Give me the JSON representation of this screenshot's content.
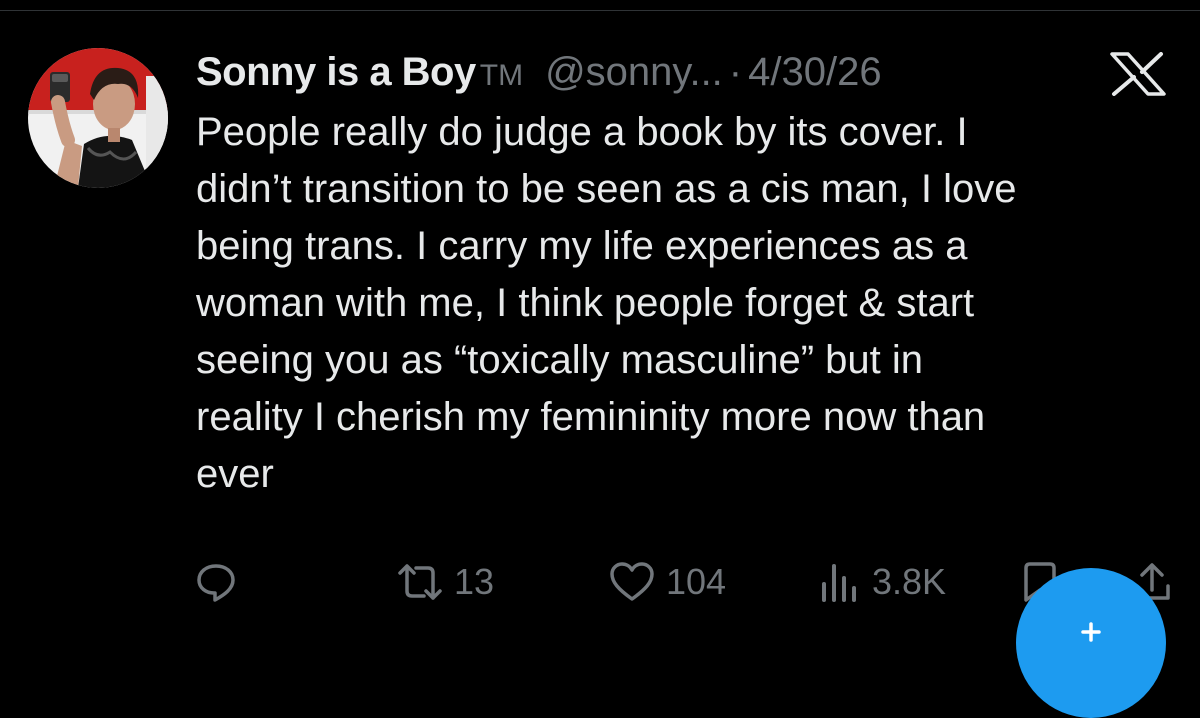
{
  "tweet": {
    "author": {
      "display_name": "Sonny is a Boy",
      "name_suffix": "TM",
      "handle": "@sonny...",
      "avatar_icon": "profile-photo"
    },
    "separator": "·",
    "date": "4/30/26",
    "platform_icon": "x-logo-icon",
    "text": "People really do judge a book by its cover. I\ndidn’t transition to be seen as a cis man, I love\nbeing trans. I carry my life experiences as a\nwoman with me, I think people forget & start\nseeing you as “toxically masculine” but in\nreality I cherish my femininity more now than\never"
  },
  "actions": {
    "reply": {
      "icon": "reply-icon",
      "count": ""
    },
    "retweet": {
      "icon": "retweet-icon",
      "count": "13"
    },
    "like": {
      "icon": "heart-icon",
      "count": "104"
    },
    "views": {
      "icon": "views-icon",
      "count": "3.8K"
    },
    "bookmark": {
      "icon": "bookmark-icon"
    },
    "share": {
      "icon": "share-icon"
    }
  },
  "compose_button": {
    "icon": "plus-icon"
  },
  "colors": {
    "background": "#000000",
    "text_primary": "#e7e9ea",
    "text_secondary": "#71767b",
    "accent": "#1d9bf0"
  }
}
